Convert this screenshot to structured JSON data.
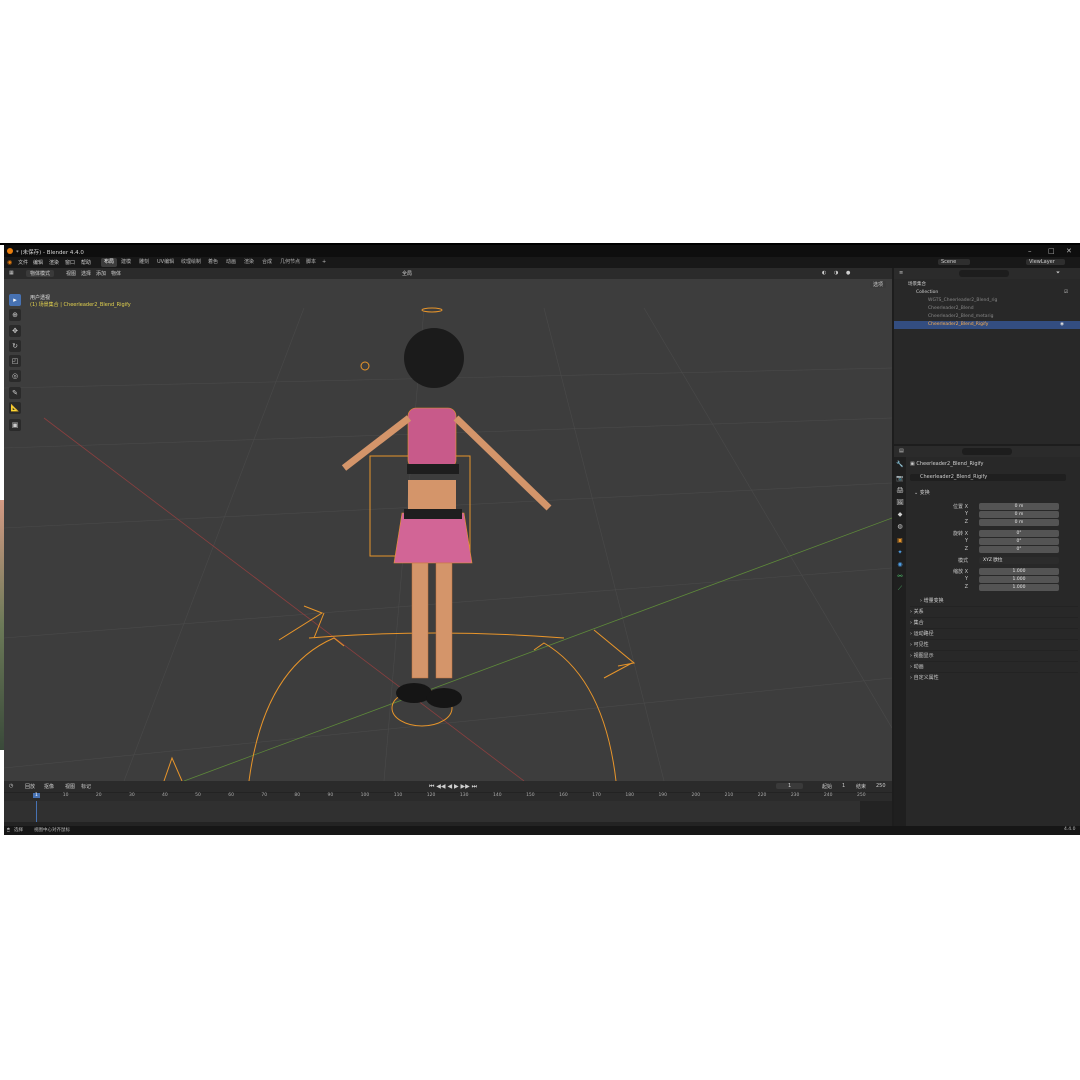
{
  "window": {
    "title": "* (未保存) - Blender 4.4.0"
  },
  "menu": [
    "文件",
    "编辑",
    "渲染",
    "窗口",
    "帮助"
  ],
  "workspaces": [
    "布局",
    "建模",
    "雕刻",
    "UV编辑",
    "纹理绘制",
    "着色",
    "动画",
    "渲染",
    "合成",
    "几何节点",
    "脚本",
    "+"
  ],
  "scene": {
    "name": "Scene",
    "view_layer": "ViewLayer"
  },
  "viewport_header": {
    "mode": "物体模式",
    "menus": [
      "视图",
      "选择",
      "添加",
      "物体"
    ],
    "transform": "全局",
    "options": "选项"
  },
  "viewport_overlay": {
    "view_name": "用户透视",
    "context": "(1) 场景集合 | Cheerleader2_Blend_Rigify"
  },
  "tools": [
    "select",
    "cursor",
    "move",
    "rotate",
    "scale",
    "transform",
    "annotate",
    "measure",
    "add-cube"
  ],
  "outliner": {
    "search_placeholder": "",
    "rows": [
      {
        "label": "场景集合",
        "indent": 0,
        "selected": false
      },
      {
        "label": "Collection",
        "indent": 1,
        "selected": false
      },
      {
        "label": "WGTS_Cheerleader2_Blend_rig",
        "indent": 2,
        "selected": false
      },
      {
        "label": "Cheerleader2_Blend",
        "indent": 2,
        "selected": false
      },
      {
        "label": "Cheerleader2_Blend_metarig",
        "indent": 2,
        "selected": false
      },
      {
        "label": "Cheerleader2_Blend_Rigify",
        "indent": 2,
        "selected": true
      }
    ]
  },
  "properties": {
    "search_placeholder": "",
    "object_path": "Cheerleader2_Blend_Rigify",
    "object_name": "Cheerleader2_Blend_Rigify",
    "section_transform": "变换",
    "location_label": "位置 X",
    "rotation_label": "旋转 X",
    "scale_label": "缩放 X",
    "axis_y": "Y",
    "axis_z": "Z",
    "location": [
      "0 m",
      "0 m",
      "0 m"
    ],
    "rotation": [
      "0°",
      "0°",
      "0°"
    ],
    "mode_label": "模式",
    "mode_value": "XYZ 欧拉",
    "scale": [
      "1.000",
      "1.000",
      "1.000"
    ],
    "delta_transform": "增量变换",
    "panels": [
      "关系",
      "集合",
      "运动路径",
      "可见性",
      "视图显示",
      "动画",
      "自定义属性"
    ]
  },
  "timeline": {
    "menus": [
      "回放",
      "抠像",
      "视图",
      "标记"
    ],
    "current_frame": "1",
    "start_label": "起始",
    "start": "1",
    "end_label": "结束",
    "end": "250",
    "ticks": [
      "1",
      "10",
      "20",
      "30",
      "40",
      "50",
      "60",
      "70",
      "80",
      "90",
      "100",
      "110",
      "120",
      "130",
      "140",
      "150",
      "160",
      "170",
      "180",
      "190",
      "200",
      "210",
      "220",
      "230",
      "240",
      "250"
    ]
  },
  "status_bar": {
    "left": "选择",
    "middle": "视图中心对齐鼠标",
    "version": "4.4.0"
  },
  "colors": {
    "accent": "#4772b3",
    "selection_orange": "#e8952a",
    "viewport_bg": "#3d3d3d"
  }
}
